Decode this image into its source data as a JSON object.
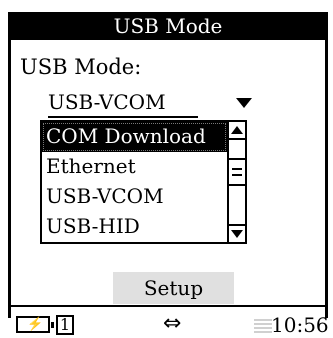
{
  "window": {
    "title": "USB Mode"
  },
  "form": {
    "label": "USB Mode:",
    "selected_value": "USB-VCOM"
  },
  "dropdown": {
    "options": [
      "COM Download",
      "Ethernet",
      "USB-VCOM",
      "USB-HID"
    ],
    "highlighted_index": 0
  },
  "buttons": {
    "setup": "Setup"
  },
  "status": {
    "slot": "1",
    "usb_glyph": "⇔",
    "time": "10:56"
  },
  "icons": [
    "battery-charging-icon",
    "usb-icon",
    "signal-icon",
    "scroll-up-icon",
    "scroll-down-icon"
  ]
}
